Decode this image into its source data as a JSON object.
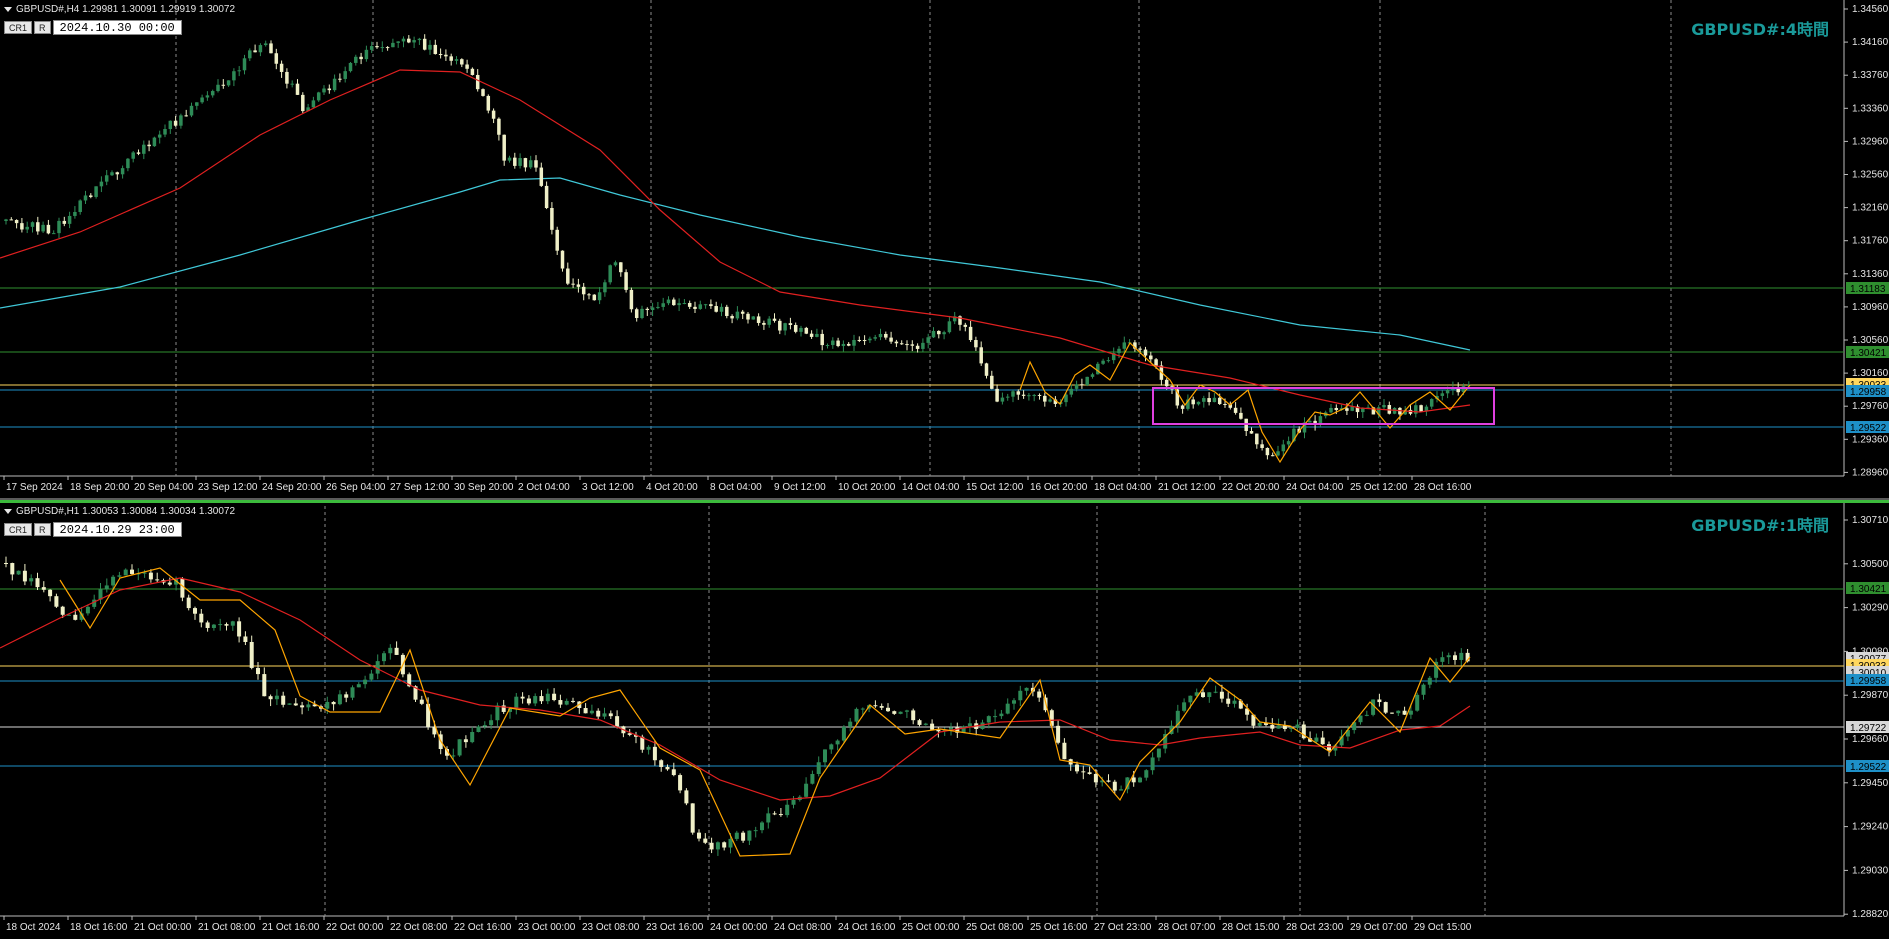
{
  "colors": {
    "background": "#000000",
    "bull_candle": "#2e8b57",
    "bear_candle": "#f0f0c8",
    "ma_fast": "#e02020",
    "ma_slow": "#40c8d8",
    "zigzag": "#ffa500",
    "level_green": "#2f8f2f",
    "level_gold": "#ffd75e",
    "level_cyan": "#1e90c8",
    "level_white": "#d8d8d8",
    "range_box": "#e040e0",
    "grid_dash": "#8a8a8a",
    "title": "#1a9a9a"
  },
  "top": {
    "info": "GBPUSD#,H4  1.29981 1.30091 1.29919 1.30072",
    "btn_cr": "CR1",
    "btn_r": "R",
    "date": "2024.10.30 00:00",
    "title": "GBPUSD#:4時間",
    "price_axis": [
      "1.34560",
      "1.34160",
      "1.33760",
      "1.33360",
      "1.32960",
      "1.32560",
      "1.32160",
      "1.31760",
      "1.31360",
      "1.30960",
      "1.30560",
      "1.30160",
      "1.29760",
      "1.29360",
      "1.28960"
    ],
    "time_axis": [
      "17 Sep 2024",
      "18 Sep 20:00",
      "20 Sep 04:00",
      "23 Sep 12:00",
      "24 Sep 20:00",
      "26 Sep 04:00",
      "27 Sep 12:00",
      "30 Sep 20:00",
      "2 Oct 04:00",
      "3 Oct 12:00",
      "4 Oct 20:00",
      "8 Oct 04:00",
      "9 Oct 12:00",
      "10 Oct 20:00",
      "14 Oct 04:00",
      "15 Oct 12:00",
      "16 Oct 20:00",
      "18 Oct 04:00",
      "21 Oct 12:00",
      "22 Oct 20:00",
      "24 Oct 04:00",
      "25 Oct 12:00",
      "28 Oct 16:00"
    ],
    "level_labels": [
      {
        "price": "1.31183",
        "color": "#2f8f2f"
      },
      {
        "price": "1.30421",
        "color": "#2f8f2f"
      },
      {
        "price": "1.30033",
        "color": "#ffd75e"
      },
      {
        "price": "1.29958",
        "color": "#1e90c8"
      },
      {
        "price": "1.29522",
        "color": "#1e90c8"
      }
    ]
  },
  "bottom": {
    "info": "GBPUSD#,H1  1.30053 1.30084 1.30034 1.30072",
    "btn_cr": "CR1",
    "btn_r": "R",
    "date": "2024.10.29 23:00",
    "title": "GBPUSD#:1時間",
    "price_axis": [
      "1.30710",
      "1.30500",
      "1.30290",
      "1.30080",
      "1.29870",
      "1.29660",
      "1.29450",
      "1.29240",
      "1.29030",
      "1.28820"
    ],
    "time_axis": [
      "18 Oct 2024",
      "18 Oct 16:00",
      "21 Oct 00:00",
      "21 Oct 08:00",
      "21 Oct 16:00",
      "22 Oct 00:00",
      "22 Oct 08:00",
      "22 Oct 16:00",
      "23 Oct 00:00",
      "23 Oct 08:00",
      "23 Oct 16:00",
      "24 Oct 00:00",
      "24 Oct 08:00",
      "24 Oct 16:00",
      "25 Oct 00:00",
      "25 Oct 08:00",
      "25 Oct 16:00",
      "27 Oct 23:00",
      "28 Oct 07:00",
      "28 Oct 15:00",
      "28 Oct 23:00",
      "29 Oct 07:00",
      "29 Oct 15:00"
    ],
    "level_labels": [
      {
        "price": "1.30421",
        "color": "#2f8f2f"
      },
      {
        "price": "1.30077",
        "color": "#d8d8d8"
      },
      {
        "price": "1.30033",
        "color": "#ffd75e"
      },
      {
        "price": "1.30010",
        "color": "#d8d8d8"
      },
      {
        "price": "1.29958",
        "color": "#1e90c8"
      },
      {
        "price": "1.29722",
        "color": "#d8d8d8"
      },
      {
        "price": "1.29522",
        "color": "#1e90c8"
      }
    ]
  }
}
